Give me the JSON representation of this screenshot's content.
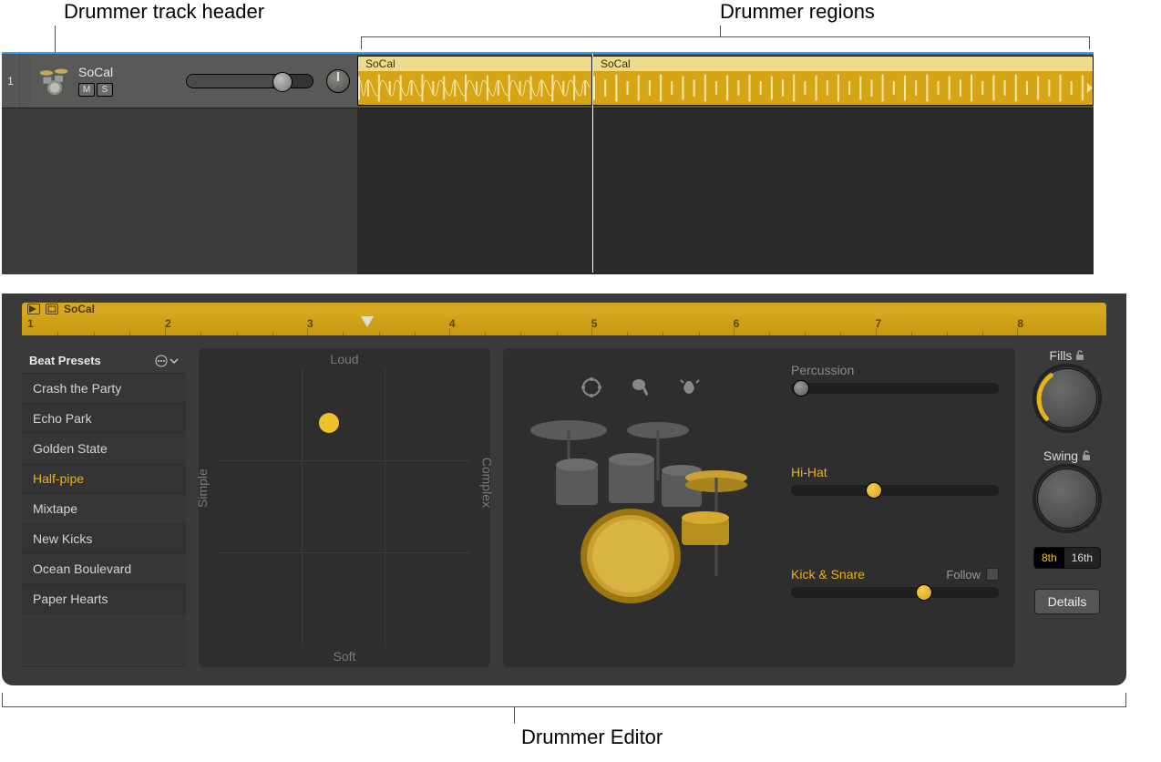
{
  "callouts": {
    "track_header": "Drummer track header",
    "regions": "Drummer regions",
    "editor": "Drummer Editor"
  },
  "track": {
    "number": "1",
    "name": "SoCal",
    "mute": "M",
    "solo": "S"
  },
  "regions": [
    {
      "label": "SoCal"
    },
    {
      "label": "SoCal"
    }
  ],
  "ruler": {
    "title": "SoCal",
    "bars": [
      "1",
      "2",
      "3",
      "4",
      "5",
      "6",
      "7",
      "8"
    ]
  },
  "presets": {
    "header": "Beat Presets",
    "items": [
      {
        "label": "Crash the Party",
        "selected": false
      },
      {
        "label": "Echo Park",
        "selected": false
      },
      {
        "label": "Golden State",
        "selected": false
      },
      {
        "label": "Half-pipe",
        "selected": true
      },
      {
        "label": "Mixtape",
        "selected": false
      },
      {
        "label": "New Kicks",
        "selected": false
      },
      {
        "label": "Ocean Boulevard",
        "selected": false
      },
      {
        "label": "Paper Hearts",
        "selected": false
      }
    ]
  },
  "xy": {
    "top": "Loud",
    "bottom": "Soft",
    "left": "Simple",
    "right": "Complex"
  },
  "sliders": {
    "percussion": {
      "label": "Percussion",
      "value_pct": 2,
      "lit": false
    },
    "hihat": {
      "label": "Hi-Hat",
      "value_pct": 38,
      "lit": true
    },
    "kicksnare": {
      "label": "Kick & Snare",
      "value_pct": 62,
      "lit": true,
      "follow_label": "Follow",
      "follow_checked": false
    }
  },
  "knobs": {
    "fills": "Fills",
    "swing": "Swing",
    "seg_a": "8th",
    "seg_b": "16th",
    "details": "Details"
  }
}
